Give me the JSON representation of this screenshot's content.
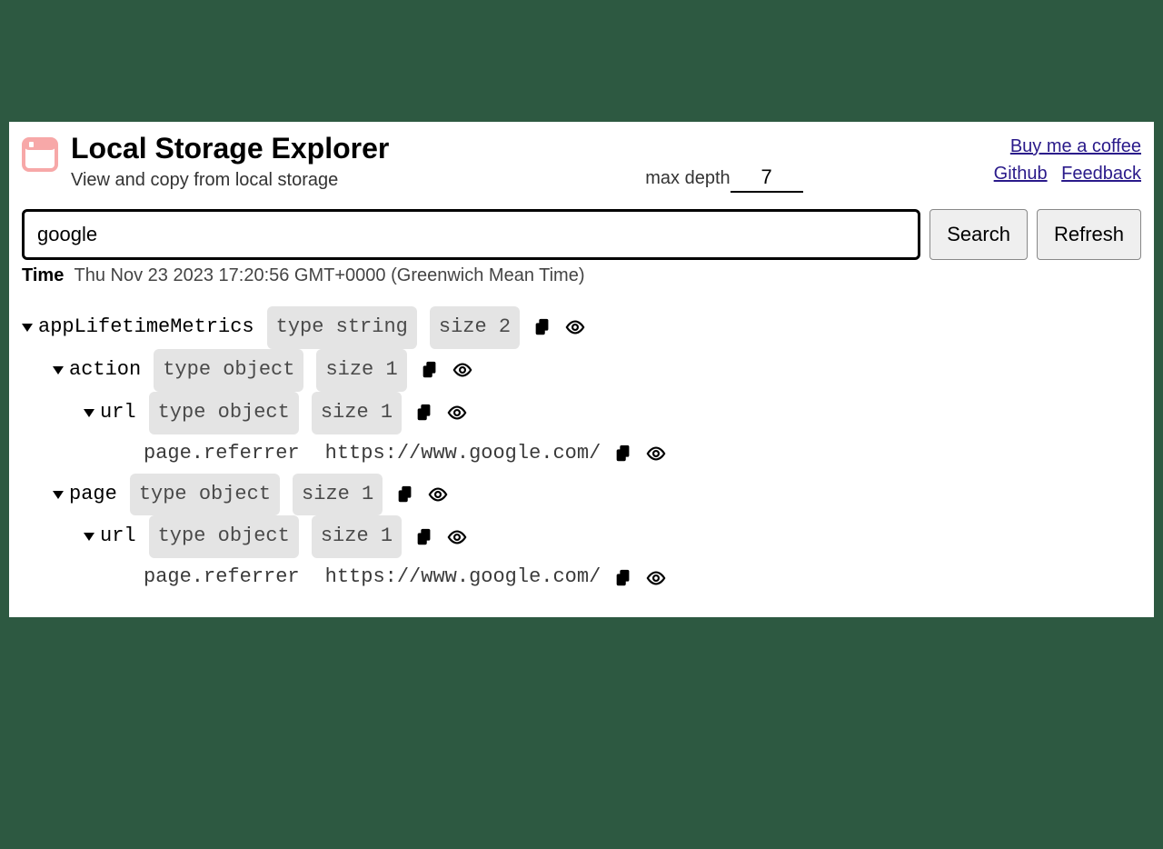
{
  "header": {
    "title": "Local Storage Explorer",
    "subtitle": "View and copy from local storage"
  },
  "depth": {
    "label": "max depth",
    "value": "7"
  },
  "links": {
    "coffee": "Buy me a coffee",
    "github": "Github",
    "feedback": "Feedback"
  },
  "search": {
    "value": "google",
    "search_btn": "Search",
    "refresh_btn": "Refresh"
  },
  "time": {
    "label": "Time",
    "value": "Thu Nov 23 2023 17:20:56 GMT+0000 (Greenwich Mean Time)"
  },
  "badges": {
    "type_string": "type string",
    "type_object": "type object",
    "size_2": "size 2",
    "size_1": "size 1"
  },
  "tree": {
    "root": {
      "key": "appLifetimeMetrics",
      "children": {
        "action": {
          "key": "action",
          "url": {
            "key": "url",
            "leaf": {
              "key": "page.referrer",
              "value": "https://www.google.com/"
            }
          }
        },
        "page": {
          "key": "page",
          "url": {
            "key": "url",
            "leaf": {
              "key": "page.referrer",
              "value": "https://www.google.com/"
            }
          }
        }
      }
    }
  }
}
